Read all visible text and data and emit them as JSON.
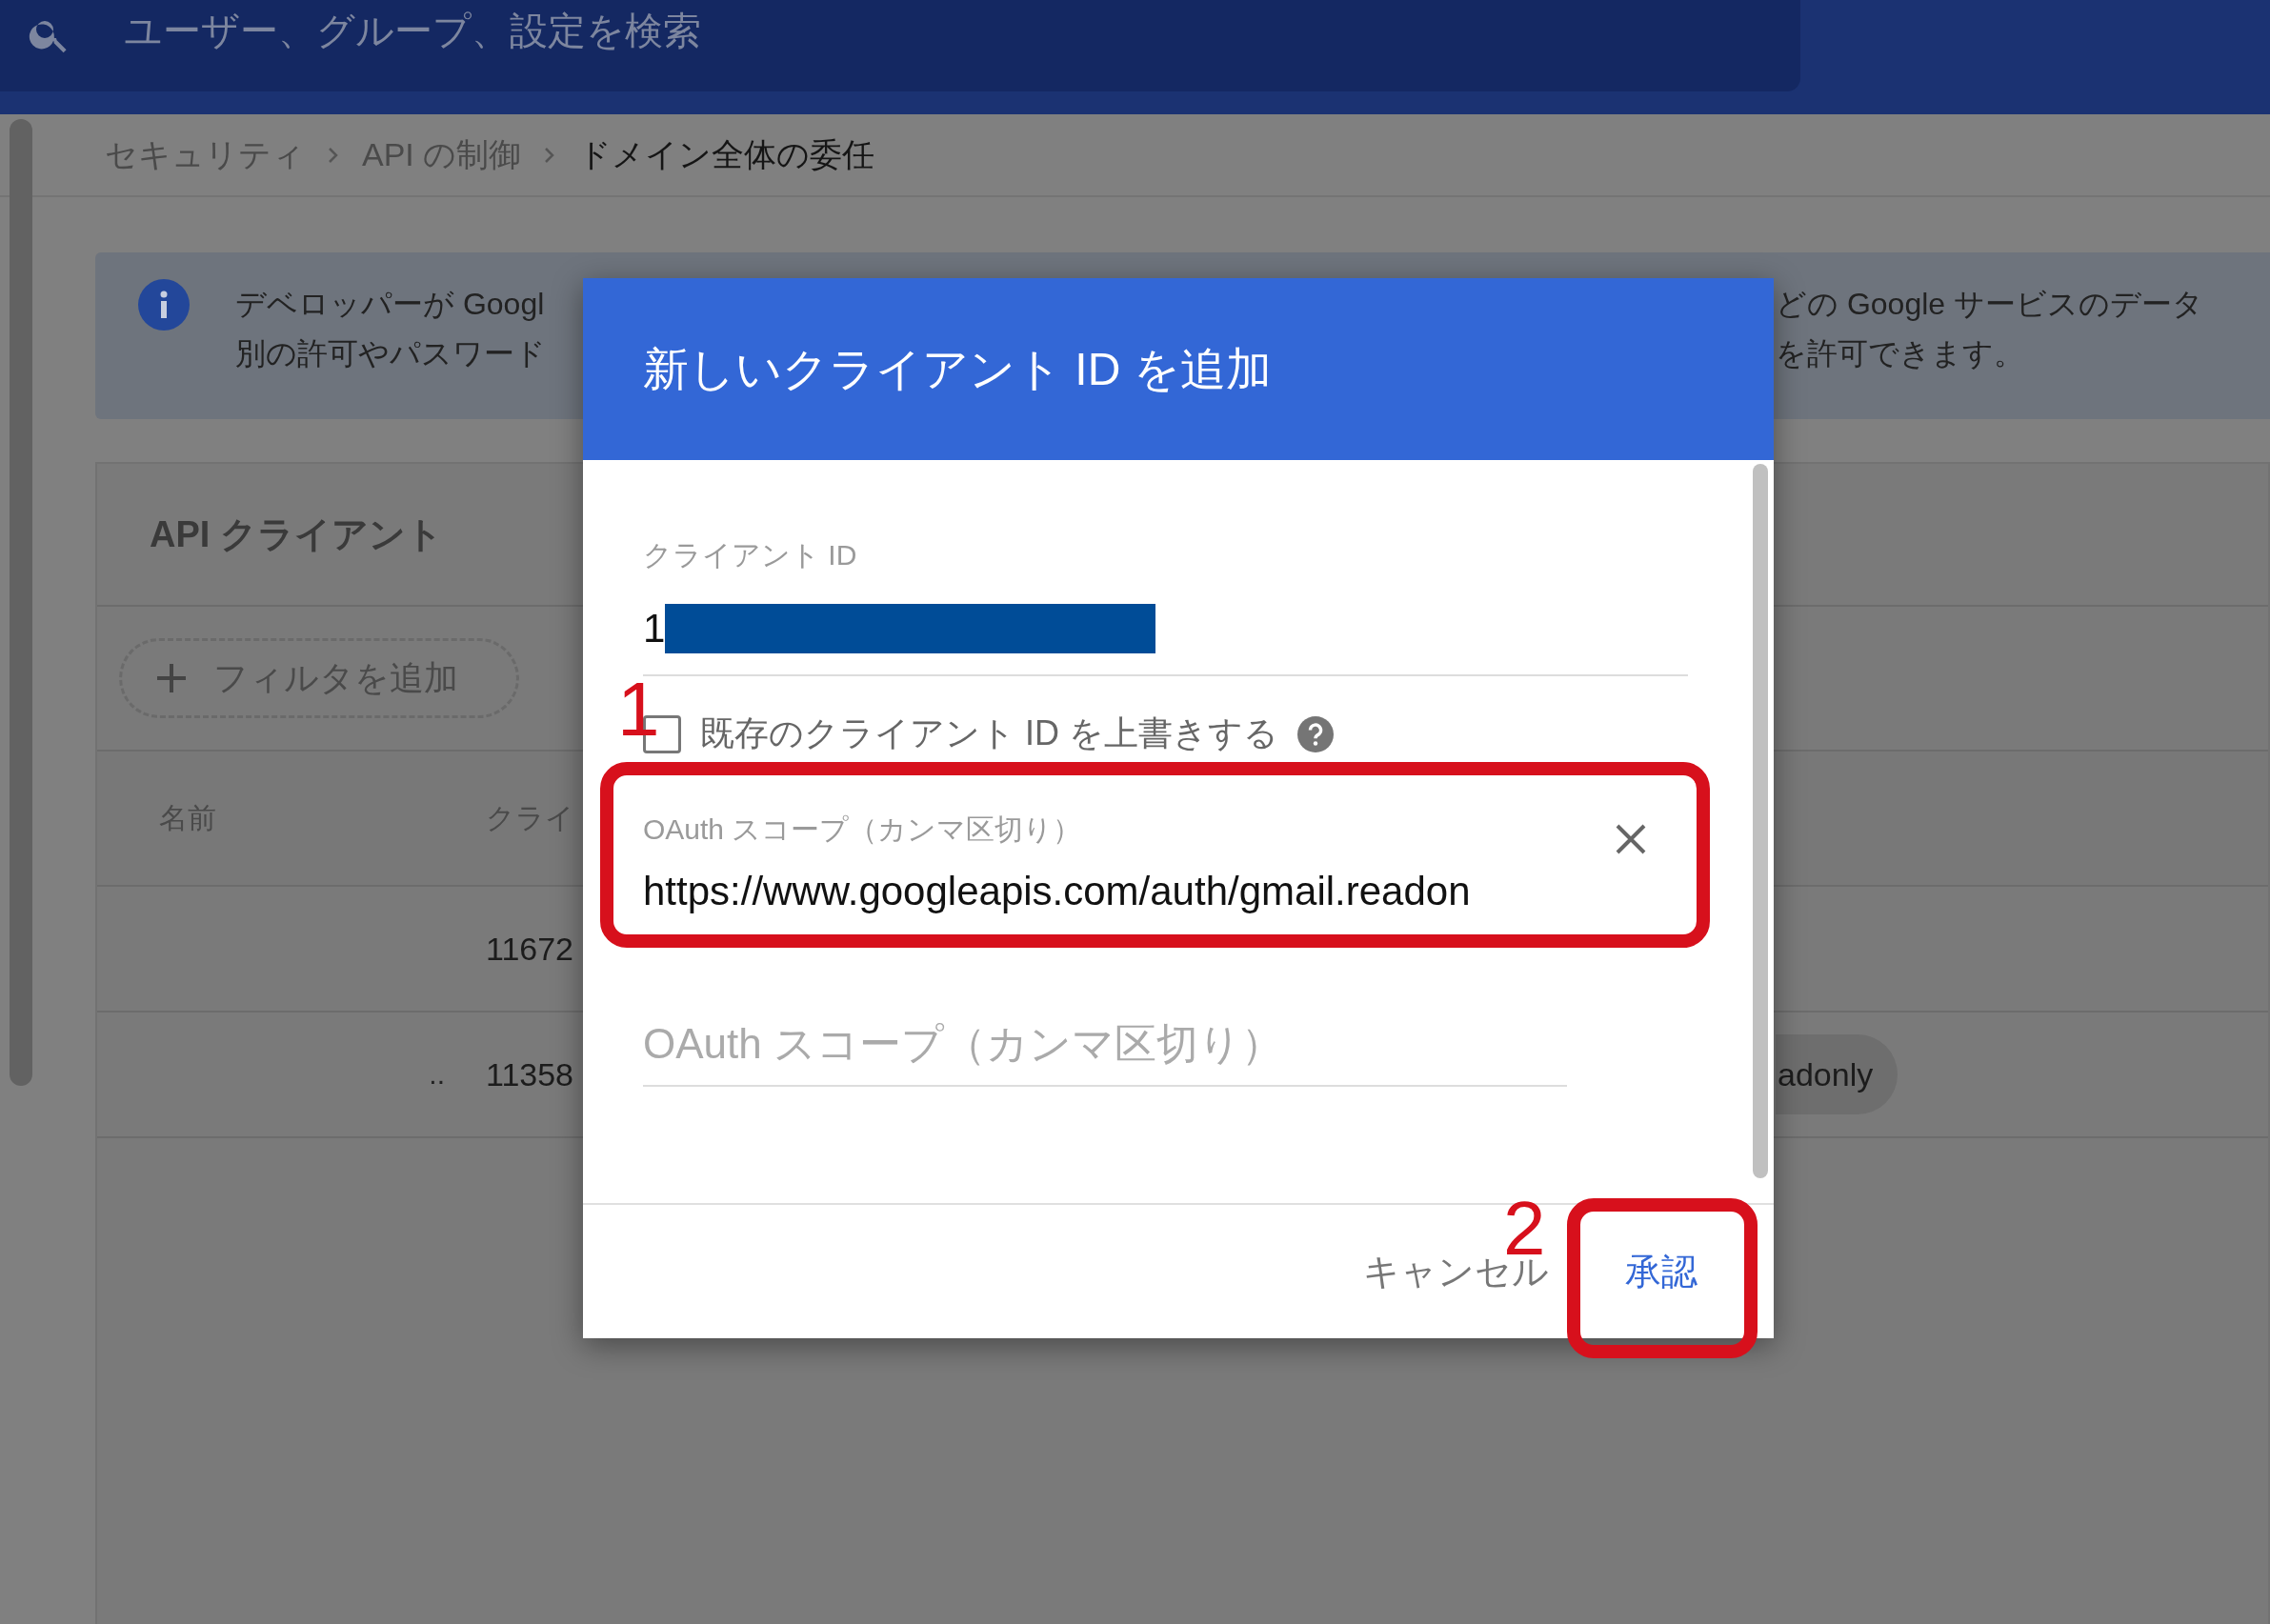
{
  "search": {
    "placeholder": "ユーザー、グループ、設定を検索"
  },
  "breadcrumb": [
    {
      "label": "セキュリティ",
      "current": false
    },
    {
      "label": "API の制御",
      "current": false
    },
    {
      "label": "ドメイン全体の委任",
      "current": true
    }
  ],
  "info_banner": {
    "text_left": [
      "デベロッパーが Googl",
      "別の許可やパスワード"
    ],
    "text_right": [
      "どの Google サービスのデータ",
      "を許可できます。"
    ]
  },
  "clients_card": {
    "title": "API クライアント",
    "filter_button": "フィルタを追加",
    "columns": [
      "名前",
      "クライ"
    ],
    "rows": [
      {
        "client_id": "11672"
      },
      {
        "name": "..",
        "client_id": "11358",
        "scopes": "adonly"
      }
    ]
  },
  "dialog": {
    "title": "新しいクライアント ID を追加",
    "client_id": {
      "label": "クライアント ID",
      "value": "1"
    },
    "overwrite": {
      "label": "既存のクライアント ID を上書きする",
      "checked": false
    },
    "scope_fields": [
      {
        "label": "OAuth スコープ（カンマ区切り）",
        "value": "https://www.googleapis.com/auth/gmail.readon"
      },
      {
        "placeholder": "OAuth スコープ（カンマ区切り）"
      }
    ],
    "buttons": [
      {
        "label": "キャンセル",
        "kind": "text"
      },
      {
        "label": "承認",
        "kind": "primary"
      }
    ]
  },
  "annotations": [
    {
      "number": "1"
    },
    {
      "number": "2"
    }
  ]
}
